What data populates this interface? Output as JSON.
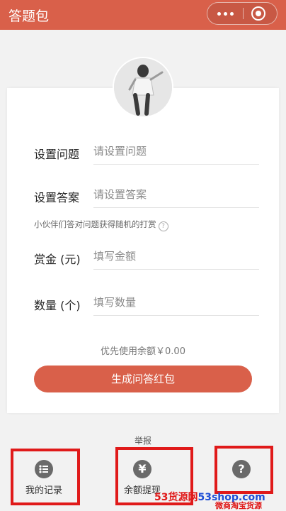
{
  "app": {
    "title": "答题包"
  },
  "form": {
    "question_label": "设置问题",
    "question_placeholder": "请设置问题",
    "answer_label": "设置答案",
    "answer_placeholder": "请设置答案",
    "hint": "小伙伴们答对问题获得随机的打赏",
    "reward_label": "赏金 (元)",
    "reward_placeholder": "填写金额",
    "quantity_label": "数量 (个)",
    "quantity_placeholder": "填写数量",
    "balance_text": "优先使用余额￥0.00",
    "submit_label": "生成问答红包"
  },
  "report_label": "举报",
  "bottom_nav": [
    {
      "label": "我的记录",
      "icon": "list-icon"
    },
    {
      "label": "余额提现",
      "icon": "yen-icon"
    },
    {
      "label": "",
      "icon": "help-icon"
    }
  ],
  "watermark": {
    "part1": "53货源网",
    "part2": "53shop.com",
    "part3": "微商淘宝货源"
  },
  "colors": {
    "accent": "#d9604a",
    "highlight": "#e01a1a"
  }
}
